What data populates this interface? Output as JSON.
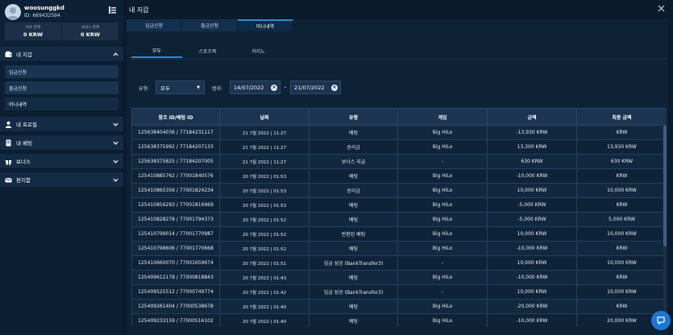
{
  "user": {
    "username": "woosunggkd",
    "id_text": "ID: 669432594",
    "balances": [
      {
        "label": "보유 잔액",
        "value": "0 KRW"
      },
      {
        "label": "보너스 잔액",
        "value": "0 KRW"
      }
    ]
  },
  "nav": {
    "wallet": "내 지갑",
    "wallet_items": [
      "입금신청",
      "출금신청",
      "머니내역"
    ],
    "profile": "내 프로필",
    "bets": "내 베팅",
    "bonus": "보너스",
    "mailbox": "편지함"
  },
  "main": {
    "title": "내 지갑",
    "tabs": [
      "입금신청",
      "출금신청",
      "머니내역"
    ],
    "subtabs": [
      "모두",
      "스포츠북",
      "카지노"
    ],
    "filter": {
      "type_label": "유형:",
      "type_value": "모두",
      "range_label": "범위:",
      "date_from": "14/07/2022",
      "date_to": "21/07/2022",
      "dash": "–"
    }
  },
  "table": {
    "headers": [
      "참조 ID/베팅 ID",
      "날짜",
      "유형",
      "게임",
      "금액",
      "최종 금액"
    ],
    "rows": [
      [
        "125638404036 / 77184231117",
        "21 7월 2022 | 11:27",
        "배팅",
        "Big HiLo",
        "-13,930 KRW",
        "KRW"
      ],
      [
        "125638375992 / 77184207133",
        "21 7월 2022 | 11:27",
        "승리금",
        "Big HiLo",
        "13,300 KRW",
        "13,930 KRW"
      ],
      [
        "125638375825 / 77184207005",
        "21 7월 2022 | 11:27",
        "보너스 지급",
        "-",
        "630 KRW",
        "630 KRW"
      ],
      [
        "125410885762 / 77001840576",
        "20 7월 2022 | 01:53",
        "배팅",
        "Big HiLo",
        "-10,000 KRW",
        "KRW"
      ],
      [
        "125410865356 / 77001824234",
        "20 7월 2022 | 01:53",
        "승리금",
        "Big HiLo",
        "10,000 KRW",
        "10,000 KRW"
      ],
      [
        "125410856293 / 77001816969",
        "20 7월 2022 | 01:53",
        "배팅",
        "Big HiLo",
        "-5,000 KRW",
        "KRW"
      ],
      [
        "125410828278 / 77001794373",
        "20 7월 2022 | 01:52",
        "배팅",
        "Big HiLo",
        "-5,000 KRW",
        "5,000 KRW"
      ],
      [
        "125410799014 / 77001770987",
        "20 7월 2022 | 01:52",
        "반환된 베팅",
        "Big HiLo",
        "10,000 KRW",
        "10,000 KRW"
      ],
      [
        "125410798606 / 77001770668",
        "20 7월 2022 | 01:52",
        "배팅",
        "Big HiLo",
        "-10,000 KRW",
        "KRW"
      ],
      [
        "125410660070 / 77001659674",
        "20 7월 2022 | 01:51",
        "입금 성공 (BankTransfer3)",
        "-",
        "10,000 KRW",
        "10,000 KRW"
      ],
      [
        "125409612178 / 77000818843",
        "20 7월 2022 | 01:43",
        "배팅",
        "Big HiLo",
        "-10,000 KRW",
        "KRW"
      ],
      [
        "125409525512 / 77000749774",
        "20 7월 2022 | 01:42",
        "입금 성공 (BankTransfer3)",
        "-",
        "10,000 KRW",
        "10,000 KRW"
      ],
      [
        "125409261404 / 77000538678",
        "20 7월 2022 | 01:40",
        "배팅",
        "Big HiLo",
        "-20,000 KRW",
        "KRW"
      ],
      [
        "125409233159 / 77000516102",
        "20 7월 2022 | 01:40",
        "배팅",
        "Big HiLo",
        "-10,000 KRW",
        "20,000 KRW"
      ]
    ]
  },
  "colors": {
    "accent": "#2e8bd8",
    "chat": "#1b78d6"
  }
}
